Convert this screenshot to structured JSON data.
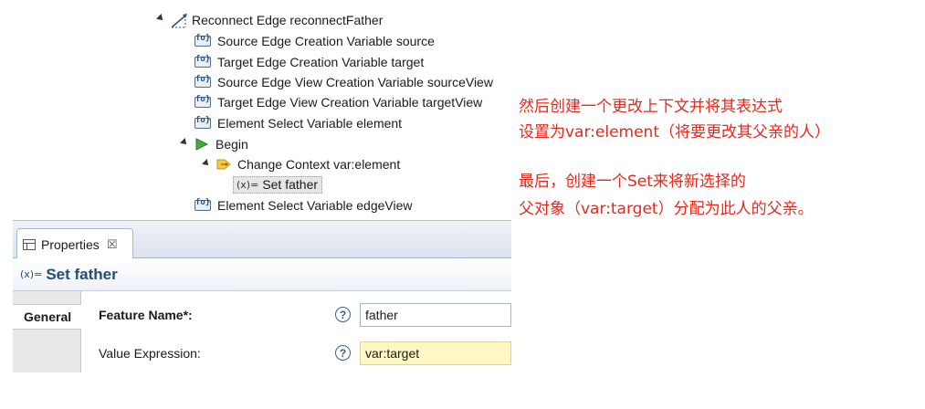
{
  "tree": {
    "root": {
      "label": "Reconnect Edge reconnectFather",
      "icon": "reconnect-edge-icon"
    },
    "variables": [
      {
        "label": "Source Edge Creation Variable source",
        "icon": "variable-icon"
      },
      {
        "label": "Target Edge Creation Variable target",
        "icon": "variable-icon"
      },
      {
        "label": "Source Edge View Creation Variable sourceView",
        "icon": "variable-icon"
      },
      {
        "label": "Target Edge View Creation Variable targetView",
        "icon": "variable-icon"
      },
      {
        "label": "Element Select Variable element",
        "icon": "variable-icon"
      }
    ],
    "begin": {
      "label": "Begin",
      "icon": "begin-icon"
    },
    "change_context": {
      "label": "Change Context var:element",
      "icon": "change-context-icon"
    },
    "set": {
      "op": "(x)=",
      "label": "Set father"
    },
    "last_variable": {
      "label": "Element Select Variable edgeView",
      "icon": "variable-icon"
    }
  },
  "properties": {
    "tab_label": "Properties",
    "tab_close": "☒",
    "title_op": "(x)=",
    "title": "Set father",
    "section_tab": "General",
    "fields": [
      {
        "label": "Feature Name*:",
        "value": "father",
        "bold": true
      },
      {
        "label": "Value Expression:",
        "value": "var:target",
        "bold": false
      }
    ],
    "help_glyph": "?"
  },
  "annotation": {
    "line1": "然后创建一个更改上下文并将其表达式",
    "line2": "设置为var:element（将要更改其父亲的人）",
    "line3": "最后，创建一个Set来将新选择的",
    "line4": "父对象（var:target）分配为此人的父亲。"
  },
  "colors": {
    "annotation": "#e8281c",
    "title": "#1f4e79",
    "yellow_field": "#fff8c4"
  }
}
